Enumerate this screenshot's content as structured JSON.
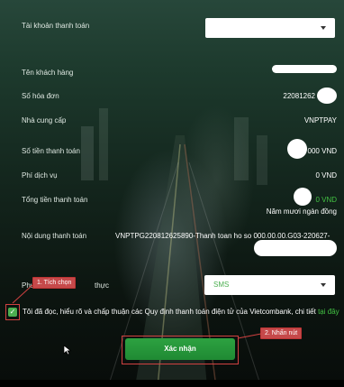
{
  "form": {
    "payment_account_label": "Tài khoản thanh toán",
    "customer_name_label": "Tên khách hàng",
    "invoice_number_label": "Số hóa đơn",
    "invoice_number_value": "22081262",
    "provider_label": "Nhà cung cấp",
    "provider_value": "VNPTPAY",
    "payment_amount_label": "Số tiền thanh toán",
    "payment_amount_value": "000 VND",
    "service_fee_label": "Phí dịch vụ",
    "service_fee_value": "0 VND",
    "total_label": "Tổng tiền thanh toán",
    "total_value": "0 VND",
    "total_in_words": "Năm mươi ngàn đồng",
    "payment_content_label": "Nội dung thanh toán",
    "payment_content_value": "VNPTPG220812625890-Thanh toan ho so 000.00.00.G03-220627-",
    "auth_method_label_start": "Phư",
    "auth_method_label_end": "thực",
    "auth_method_value": "SMS",
    "agree_text": "Tôi đã đọc, hiểu rõ và chấp thuận các Quy định thanh toán điện tử của Vietcombank, chi tiết ",
    "agree_link": "tại đây",
    "confirm_button": "Xác nhận"
  },
  "annotations": {
    "step1": "1. Tích chọn",
    "step2": "2. Nhấn nút"
  },
  "colors": {
    "accent_green": "#43c243",
    "button_green": "#2da241",
    "annotation_red": "#c6494a"
  }
}
